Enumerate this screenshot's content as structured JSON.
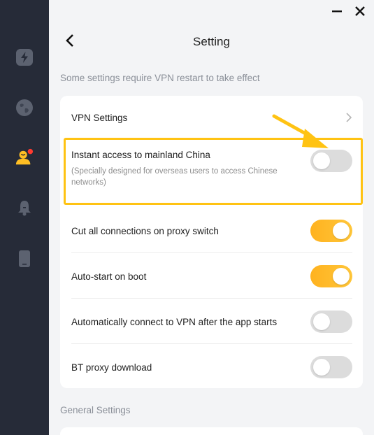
{
  "page": {
    "title": "Setting",
    "hint": "Some settings require VPN restart to take effect",
    "general_section_title": "General Settings"
  },
  "sidebar": {
    "items": [
      {
        "icon": "lightning-icon",
        "active": false
      },
      {
        "icon": "globe-icon",
        "active": false
      },
      {
        "icon": "user-icon",
        "active": true,
        "badge": true
      },
      {
        "icon": "bell-icon",
        "active": false
      },
      {
        "icon": "phone-icon",
        "active": false
      }
    ]
  },
  "window": {
    "minimize": "minimize-icon",
    "close": "close-icon"
  },
  "vpn_settings": {
    "label": "VPN Settings",
    "instant_access": {
      "label": "Instant access to mainland China",
      "description": "(Specially designed for overseas users to access Chinese networks)",
      "enabled": false
    },
    "cut_connections": {
      "label": "Cut all connections on proxy switch",
      "enabled": true
    },
    "auto_start": {
      "label": "Auto-start on boot",
      "enabled": true
    },
    "auto_connect": {
      "label": "Automatically connect to VPN after the app starts",
      "enabled": false
    },
    "bt_proxy": {
      "label": "BT proxy download",
      "enabled": false
    }
  },
  "colors": {
    "accent": "#ffb21f",
    "highlight": "#ffc313",
    "sidebar_bg": "#262b38",
    "badge": "#ff3b30"
  }
}
